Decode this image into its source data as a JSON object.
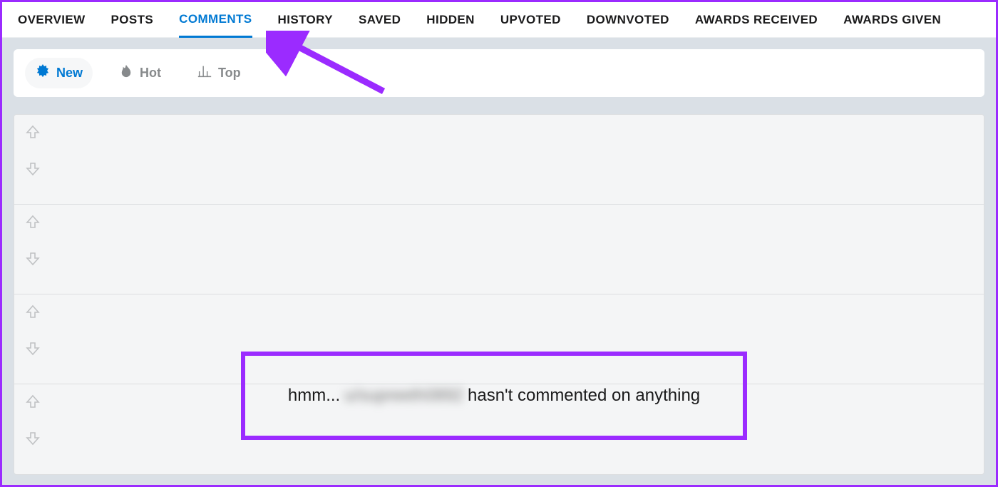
{
  "tabs": [
    {
      "label": "OVERVIEW",
      "active": false
    },
    {
      "label": "POSTS",
      "active": false
    },
    {
      "label": "COMMENTS",
      "active": true
    },
    {
      "label": "HISTORY",
      "active": false
    },
    {
      "label": "SAVED",
      "active": false
    },
    {
      "label": "HIDDEN",
      "active": false
    },
    {
      "label": "UPVOTED",
      "active": false
    },
    {
      "label": "DOWNVOTED",
      "active": false
    },
    {
      "label": "AWARDS RECEIVED",
      "active": false
    },
    {
      "label": "AWARDS GIVEN",
      "active": false
    }
  ],
  "sort": {
    "new": "New",
    "hot": "Hot",
    "top": "Top"
  },
  "empty": {
    "prefix": "hmm... ",
    "username": "u/supreeth0892",
    "suffix": " hasn't commented on anything"
  }
}
